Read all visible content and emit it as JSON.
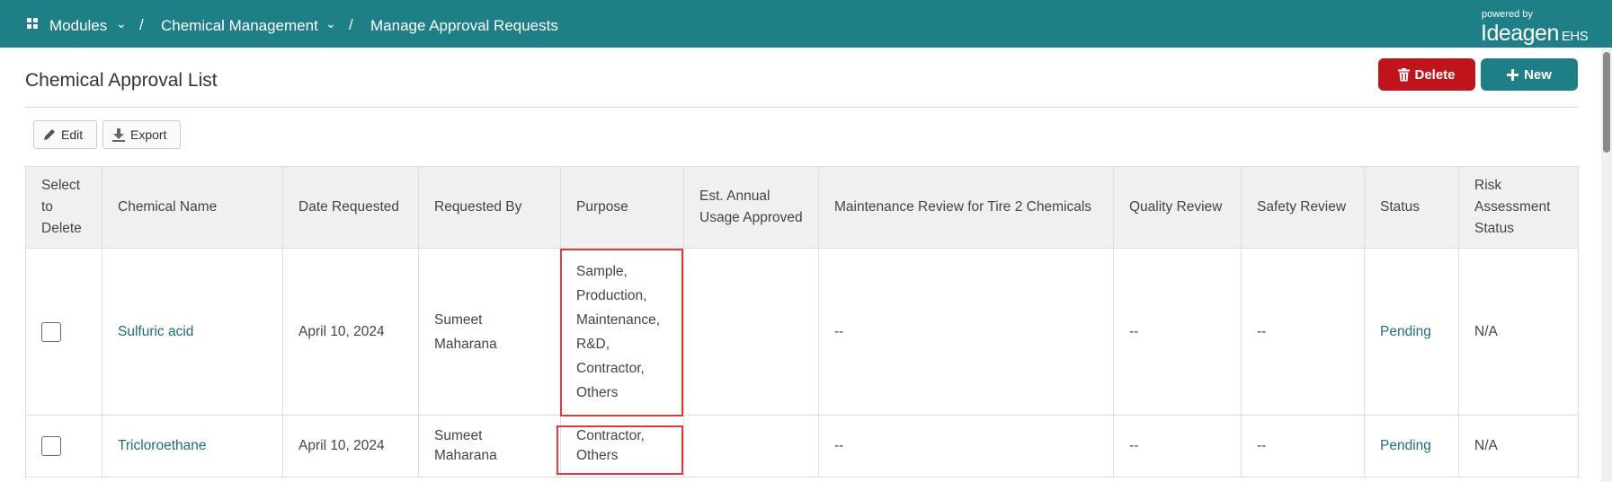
{
  "header": {
    "breadcrumb": [
      "Modules",
      "Chemical Management",
      "Manage Approval Requests"
    ],
    "separator": "/",
    "powered_by": "powered by",
    "brand": "Ideagen",
    "brand_suffix": "EHS"
  },
  "page": {
    "title": "Chemical Approval List",
    "delete_label": "Delete",
    "new_label": "New"
  },
  "toolbar": {
    "edit_label": "Edit",
    "export_label": "Export"
  },
  "table": {
    "columns": [
      "Select to Delete",
      "Chemical Name",
      "Date Requested",
      "Requested By",
      "Purpose",
      "Est. Annual Usage Approved",
      "Maintenance Review for Tire 2 Chemicals",
      "Quality Review",
      "Safety Review",
      "Status",
      "Risk Assessment Status"
    ],
    "rows": [
      {
        "chemical": "Sulfuric acid",
        "date": "April 10, 2024",
        "requested_by": "Sumeet Maharana",
        "purpose": "Sample, Production, Maintenance, R&D, Contractor, Others",
        "usage": "",
        "maintenance": "--",
        "quality": "--",
        "safety": "--",
        "status": "Pending",
        "risk": "N/A"
      },
      {
        "chemical": "Tricloroethane",
        "date": "April 10, 2024",
        "requested_by": "Sumeet Maharana",
        "purpose": "Contractor, Others",
        "usage": "",
        "maintenance": "--",
        "quality": "--",
        "safety": "--",
        "status": "Pending",
        "risk": "N/A"
      }
    ]
  },
  "colors": {
    "header_bg": "#1e7f86",
    "delete_bg": "#c0141c",
    "link": "#1e6e74",
    "highlight": "#e03a3e"
  }
}
